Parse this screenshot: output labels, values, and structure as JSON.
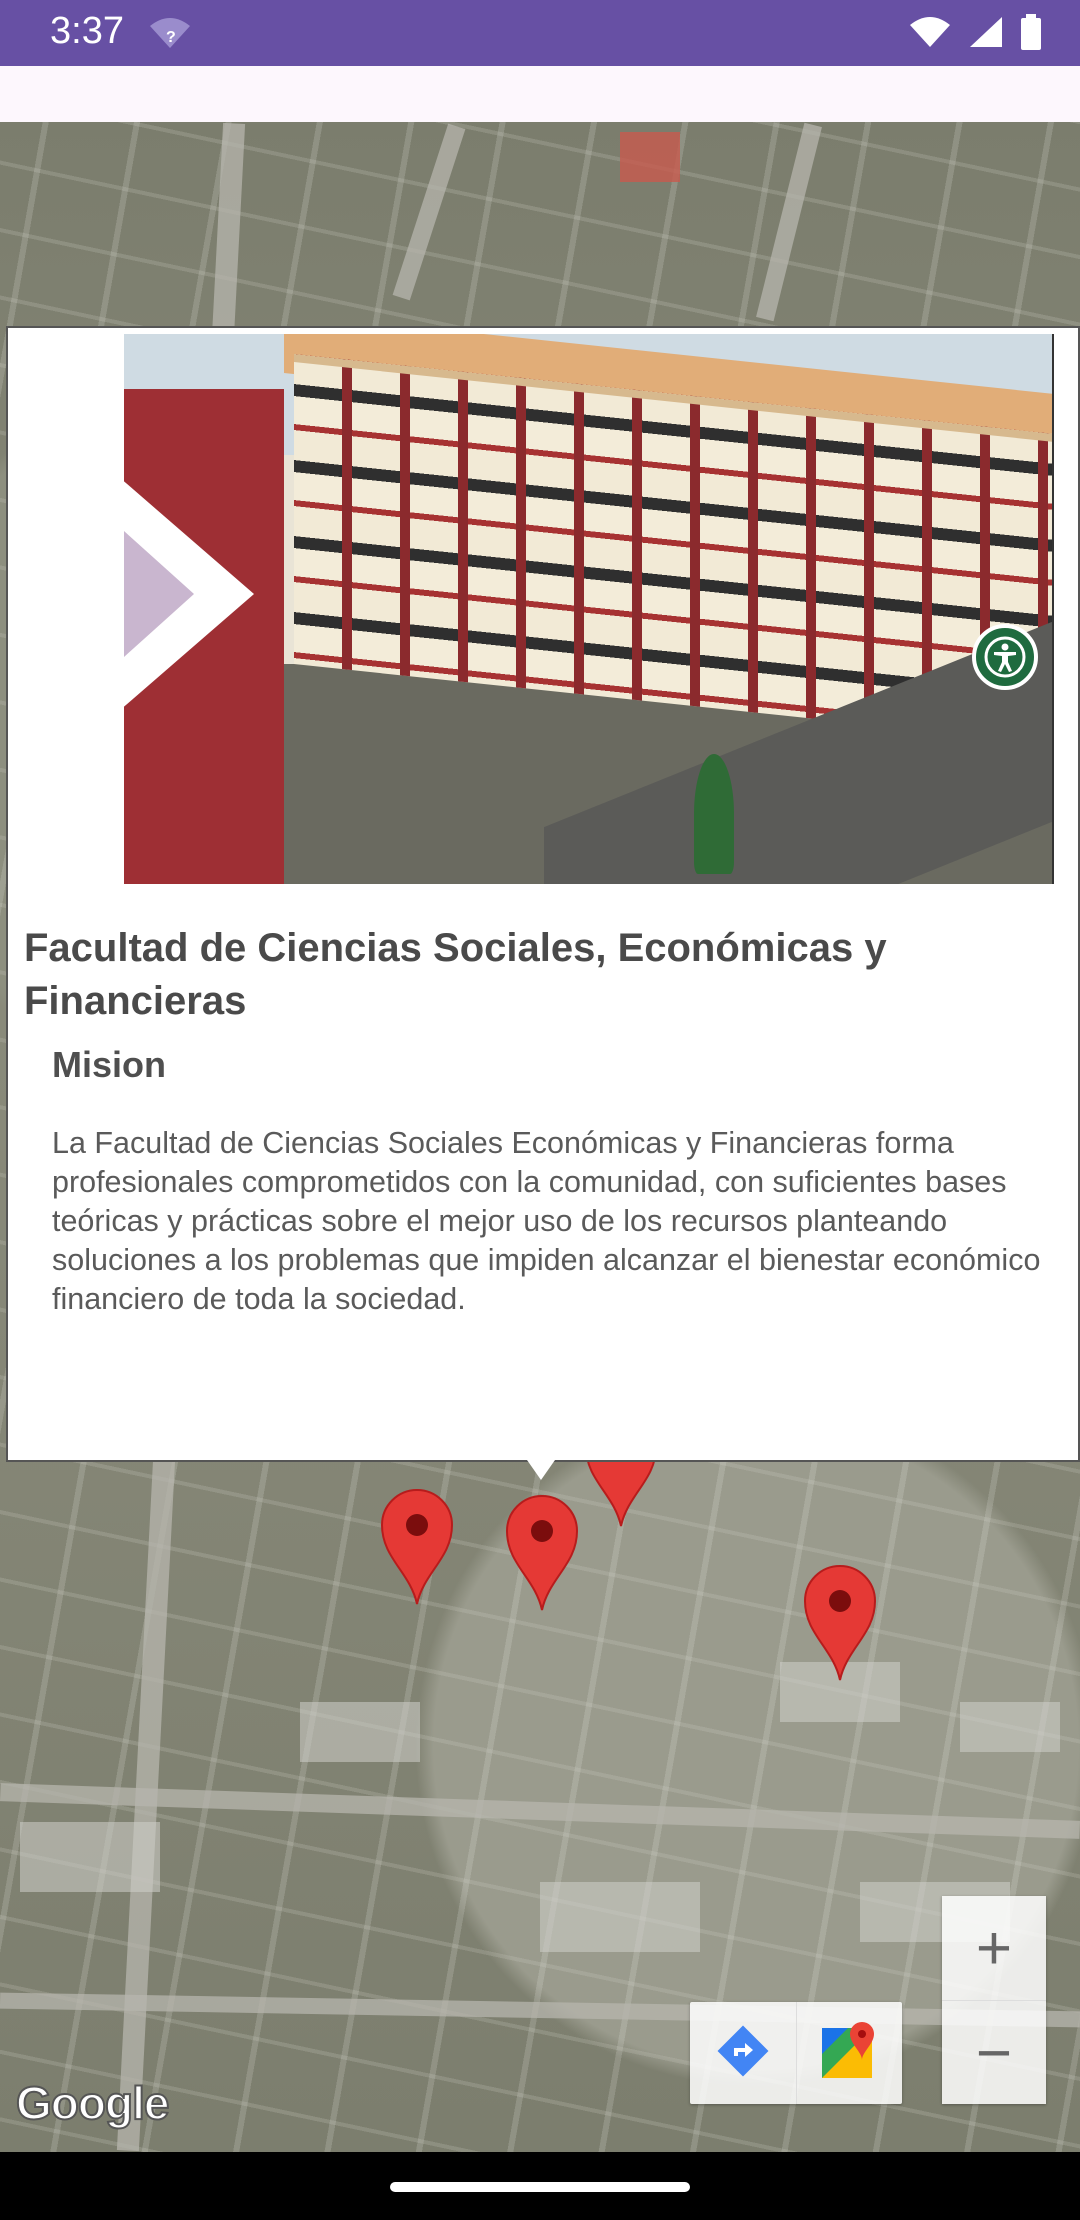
{
  "status_bar": {
    "time": "3:37",
    "icons": [
      "wifi-question-icon",
      "wifi-icon",
      "signal-icon",
      "battery-icon"
    ]
  },
  "info_window": {
    "title": "Facultad de Ciencias Sociales, Económicas y Financieras",
    "subtitle": "Mision",
    "body": "La Facultad de Ciencias Sociales Económicas y Financieras forma profesionales comprometidos con la comunidad, con suficientes bases teóricas y prácticas sobre el mejor uso de los recursos planteando soluciones a los problemas que impiden alcanzar el bienestar económico financiero de toda la sociedad.",
    "photo_icon": "accessibility-icon"
  },
  "map": {
    "attribution": "Google",
    "marker_color": "#e53935",
    "toolbar": [
      "directions-icon",
      "google-maps-icon"
    ],
    "zoom": {
      "in": "+",
      "out": "−"
    }
  },
  "colors": {
    "status_bar": "#6750a4",
    "app_bar": "#fdf7fd"
  }
}
